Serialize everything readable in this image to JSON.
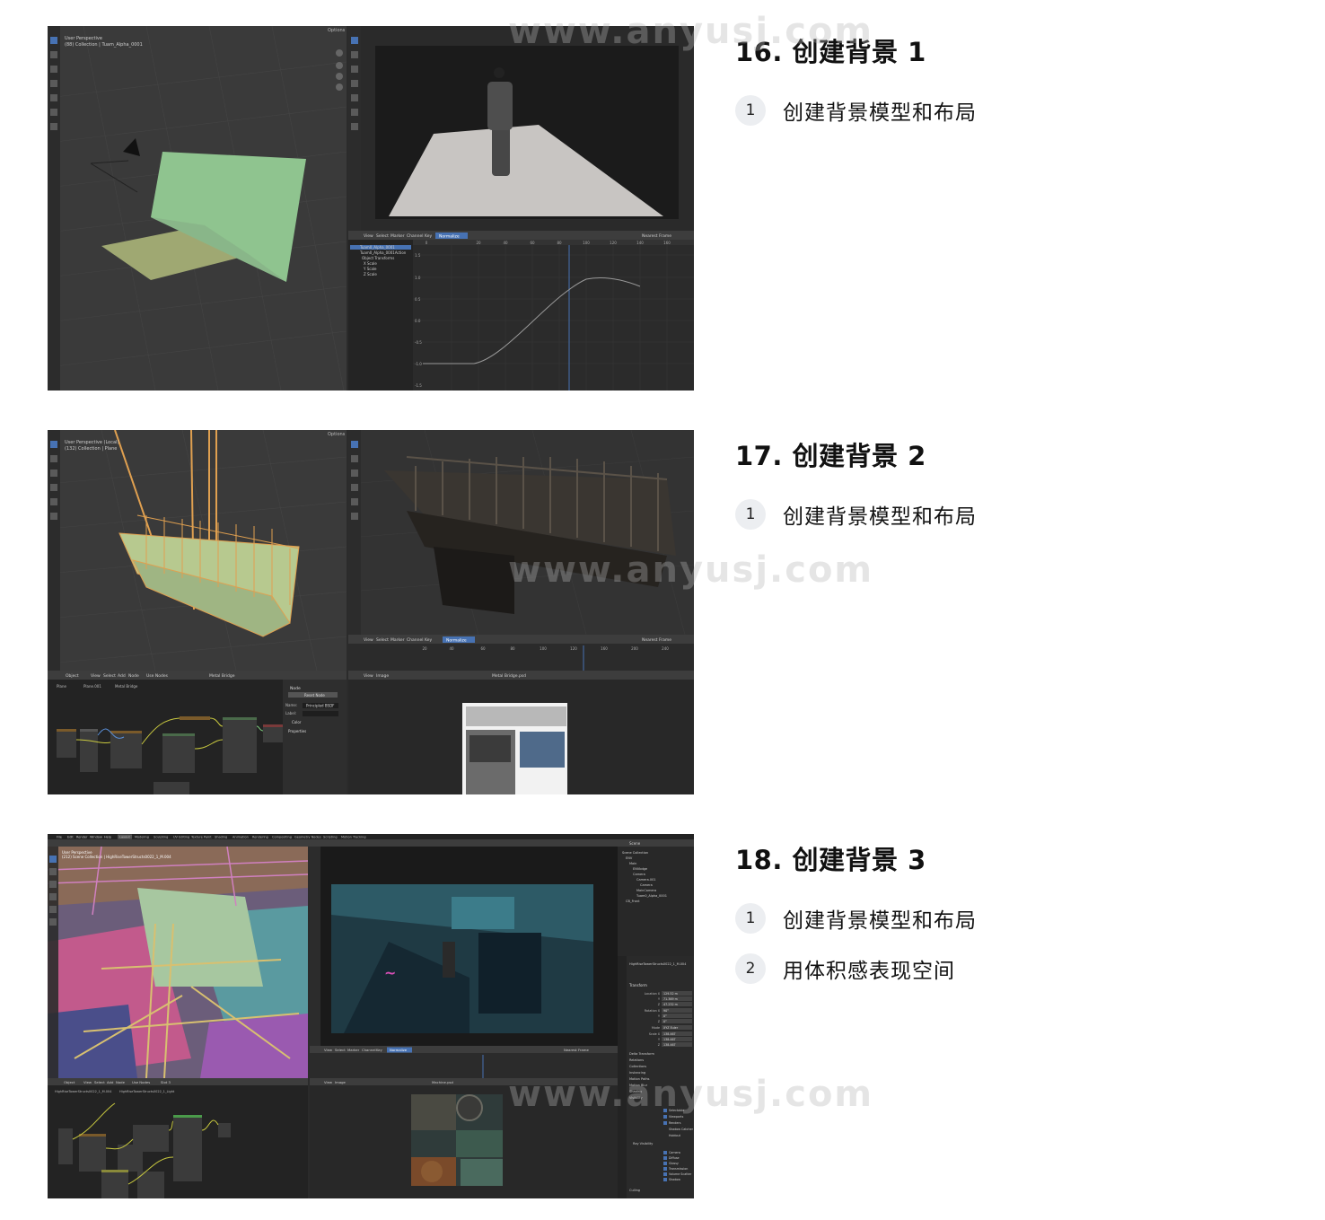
{
  "watermark": "www.anyusj.com",
  "sections": [
    {
      "title": "16. 创建背景 1",
      "steps": [
        {
          "num": "1",
          "text": "创建背景模型和布局"
        }
      ],
      "screenshot": {
        "viewport_title": "User Perspective",
        "viewport_collection": "(88) Collection | Tuam_Alpha_0001",
        "options_label": "Options",
        "graph_menu": [
          "View",
          "Select",
          "Marker",
          "Channel",
          "Key"
        ],
        "graph_mode": "Normalize",
        "graph_snap": "Nearest Frame",
        "graph_channels": [
          "Tuam0_Alpha_0001",
          "Tuam0_Alpha_0001Action",
          "Object Transforms",
          "X Scale",
          "Y Scale",
          "Z Scale"
        ],
        "graph_ticks_x": [
          "0",
          "20",
          "40",
          "60",
          "80",
          "100",
          "120",
          "140",
          "160"
        ],
        "graph_ticks_y": [
          "1.5",
          "1.0",
          "0.5",
          "0.0",
          "-0.5",
          "-1.0",
          "-1.5"
        ]
      }
    },
    {
      "title": "17. 创建背景 2",
      "steps": [
        {
          "num": "1",
          "text": "创建背景模型和布局"
        }
      ],
      "screenshot": {
        "viewport_title": "User Perspective (Local)",
        "viewport_collection": "(132) Collection | Plane",
        "options_label": "Options",
        "node_header": "Object",
        "node_menu": [
          "View",
          "Select",
          "Add",
          "Node",
          "Use Nodes"
        ],
        "material_name": "Metal Bridge",
        "breadcrumb": [
          "Plane",
          "Plane.001",
          "Metal Bridge"
        ],
        "node_panel_title": "Node",
        "node_name_label": "Name:",
        "node_name_value": "Principled BSDF",
        "node_label_label": "Label:",
        "node_reset": "Reset Node",
        "node_sections": [
          "Color",
          "Properties"
        ],
        "image_menu": [
          "View",
          "Image"
        ],
        "image_name": "Metal Bridge.psd",
        "graph_menu": [
          "View",
          "Select",
          "Marker",
          "Channel",
          "Key"
        ],
        "graph_mode": "Normalize",
        "graph_snap": "Nearest Frame",
        "graph_ticks_x": [
          "20",
          "40",
          "60",
          "80",
          "100",
          "120",
          "160",
          "200",
          "240"
        ]
      }
    },
    {
      "title": "18. 创建背景 3",
      "steps": [
        {
          "num": "1",
          "text": "创建背景模型和布局"
        },
        {
          "num": "2",
          "text": "用体积感表现空间"
        }
      ],
      "screenshot": {
        "top_menu": [
          "File",
          "Edit",
          "Render",
          "Window",
          "Help"
        ],
        "workspaces": [
          "Layout",
          "Modeling",
          "Sculpting",
          "UV Editing",
          "Texture Paint",
          "Shading",
          "Animation",
          "Rendering",
          "Compositing",
          "Geometry Nodes",
          "Scripting",
          "Motion Tracking"
        ],
        "viewport_title": "User Perspective",
        "viewport_collection": "(212) Scene Collection | HighRiseTowerStructs0022_1_M.004",
        "outliner_header": "Scene",
        "outliner_items": [
          "Scene Collection",
          "ENV",
          "Main",
          "ENVbdge",
          "Camera",
          "Camera.001",
          "Camera",
          "MainCamera",
          "Tuam0_Alpha_0001",
          "CB_Front"
        ],
        "properties_object": "HighRiseTowerStructs0022_1_M.004",
        "properties_sections": [
          "Transform",
          "Delta Transform",
          "Relations",
          "Collections",
          "Instancing",
          "Motion Paths",
          "Motion Blur",
          "Shading",
          "Visibility",
          "Ray Visibility",
          "Culling"
        ],
        "transform_labels": [
          "Location X",
          "Y",
          "Z",
          "Rotation X",
          "Y",
          "Z",
          "Mode",
          "Scale X",
          "Y",
          "Z"
        ],
        "transform_values": [
          "129.52 m",
          "71.369 m",
          "47.232 m",
          "90°",
          "0°",
          "0°",
          "XYZ Euler",
          "138.467",
          "138.467",
          "138.467"
        ],
        "ray_visibility": [
          "Camera",
          "Diffuse",
          "Glossy",
          "Transmission",
          "Volume Scatter",
          "Shadow"
        ],
        "visibility_items": [
          "Selectable",
          "Viewports",
          "Renders",
          "Shadow Catcher",
          "Holdout"
        ],
        "graph_menu": [
          "View",
          "Select",
          "Marker",
          "Channel",
          "Key"
        ],
        "graph_mode": "Normalize",
        "graph_snap": "Nearest Frame",
        "node_menu": [
          "Object",
          "View",
          "Select",
          "Add",
          "Node",
          "Use Nodes",
          "Slot 3"
        ],
        "breadcrumb": [
          "HighRiseTowerStructs0022_1_M.004",
          "HighRiseTowerStructs0022_1_Light"
        ],
        "image_menu": [
          "View",
          "Image"
        ],
        "image_name": "Machine.psd"
      }
    }
  ],
  "colors": {
    "blender_bg": "#2b2b2b",
    "blender_header": "#3d3d3d",
    "grid_line": "#363636",
    "plane_green": "#8fc48f",
    "wire_orange": "#e0a050",
    "accent_blue": "#4772b3",
    "step_circle": "#eceef1"
  }
}
